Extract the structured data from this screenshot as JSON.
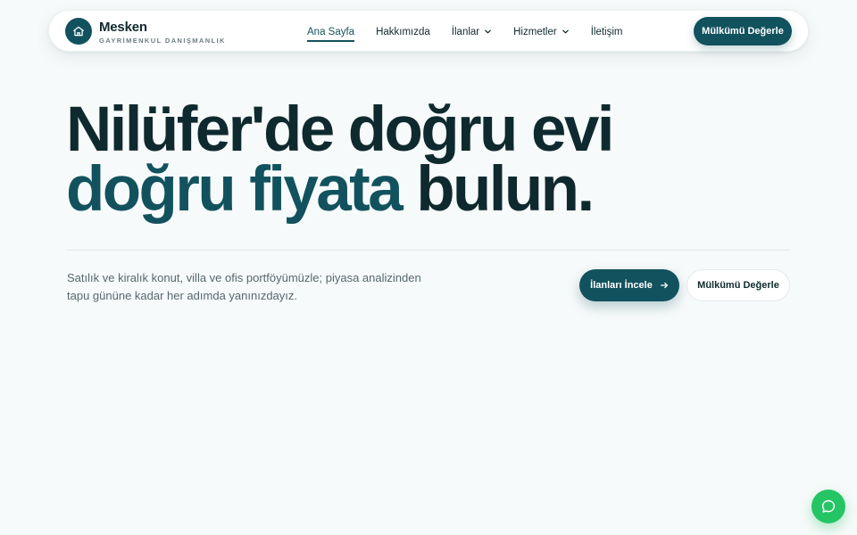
{
  "brand": {
    "name": "Mesken",
    "tagline": "GAYRİMENKUL DANIŞMANLIK",
    "logo_icon": "home-icon"
  },
  "nav": {
    "items": [
      {
        "label": "Ana Sayfa",
        "active": true
      },
      {
        "label": "Hakkımızda",
        "active": false
      },
      {
        "label": "İlanlar",
        "active": false,
        "dropdown": true
      },
      {
        "label": "Hizmetler",
        "active": false,
        "dropdown": true
      },
      {
        "label": "İletişim",
        "active": false
      }
    ],
    "cta_label": "Mülkümü Değerle"
  },
  "hero": {
    "title_line1": "Nilüfer'de doğru evi",
    "title_accent": "doğru fiyata",
    "title_rest": " bulun.",
    "description": "Satılık ve kiralık konut, villa ve ofis portföyümüzle; piyasa analizinden tapu gününe kadar her adımda yanınızdayız.",
    "primary_button": "İlanları İncele",
    "secondary_button": "Mülkümü Değerle"
  },
  "chat": {
    "icon": "chat-bubble-icon"
  },
  "colors": {
    "brand": "#12525e",
    "text": "#0f2a2e",
    "muted": "#55686c",
    "background": "#f7fafa",
    "chat": "#25c464"
  }
}
